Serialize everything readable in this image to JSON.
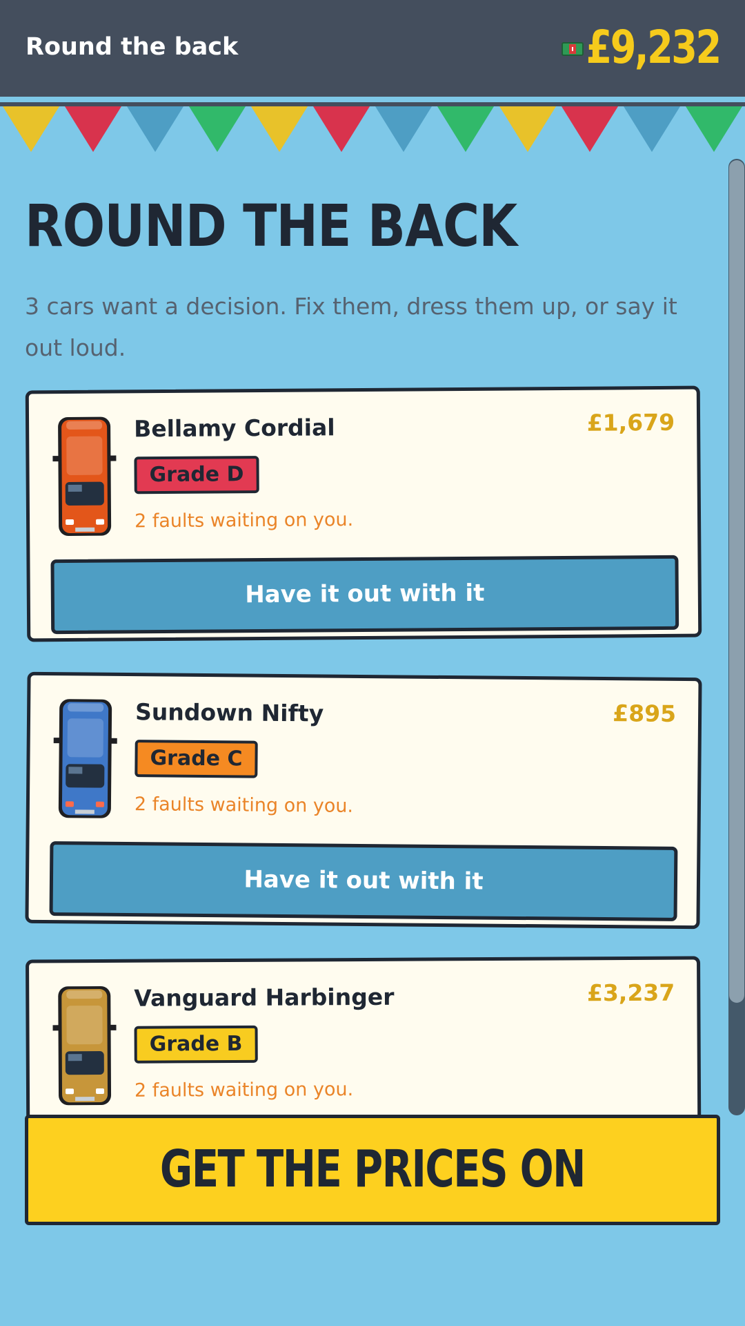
{
  "header": {
    "title": "Round the back",
    "cash": "£9,232",
    "cash_icon": "banknote-icon"
  },
  "page": {
    "heading": "ROUND THE BACK",
    "subtitle": "3 cars want a decision. Fix them, dress them up, or say it out loud."
  },
  "colors": {
    "background": "#7ec8e8",
    "topbar": "#444e5d",
    "cash": "#f6cb1c",
    "card": "#fffcef",
    "button": "#4e9ec4",
    "cta": "#fdd01f",
    "fault_text": "#ea8428",
    "price": "#d9a51a",
    "bunting": [
      "#e8c22a",
      "#d8334d",
      "#4e9ec4",
      "#31b96a"
    ]
  },
  "cars": [
    {
      "name": "Bellamy Cordial",
      "price": "£1,679",
      "grade": "Grade D",
      "grade_color": "#e23a52",
      "faults": "2 faults waiting on you.",
      "action": "Have it out with it",
      "car_color": "#e3561a",
      "sprite_icon": "orange-car-icon"
    },
    {
      "name": "Sundown Nifty",
      "price": "£895",
      "grade": "Grade C",
      "grade_color": "#f58a22",
      "faults": "2 faults waiting on you.",
      "action": "Have it out with it",
      "car_color": "#3f78c8",
      "sprite_icon": "blue-car-icon"
    },
    {
      "name": "Vanguard Harbinger",
      "price": "£3,237",
      "grade": "Grade B",
      "grade_color": "#f8cc20",
      "faults": "2 faults waiting on you.",
      "car_color": "#c7963a",
      "sprite_icon": "gold-car-icon"
    }
  ],
  "cta": {
    "label": "GET THE PRICES ON"
  }
}
